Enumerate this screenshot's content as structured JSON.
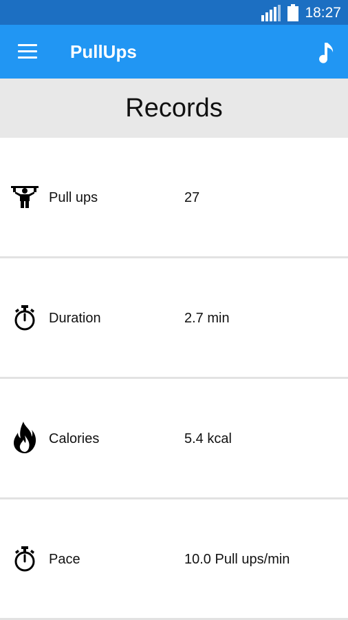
{
  "status_bar": {
    "time": "18:27",
    "icons": [
      "signal-icon",
      "battery-icon"
    ]
  },
  "app_bar": {
    "title": "PullUps",
    "menu_icon": "hamburger-menu-icon",
    "action_icon": "music-note-icon",
    "color": "#2196f3"
  },
  "header": {
    "title": "Records",
    "background": "#e8e8e8"
  },
  "records": [
    {
      "icon": "pull-up-icon",
      "label": "Pull ups",
      "value": "27"
    },
    {
      "icon": "stopwatch-icon",
      "label": "Duration",
      "value": "2.7 min"
    },
    {
      "icon": "flame-icon",
      "label": "Calories",
      "value": "5.4 kcal"
    },
    {
      "icon": "stopwatch-icon",
      "label": "Pace",
      "value": "10.0 Pull ups/min"
    }
  ]
}
